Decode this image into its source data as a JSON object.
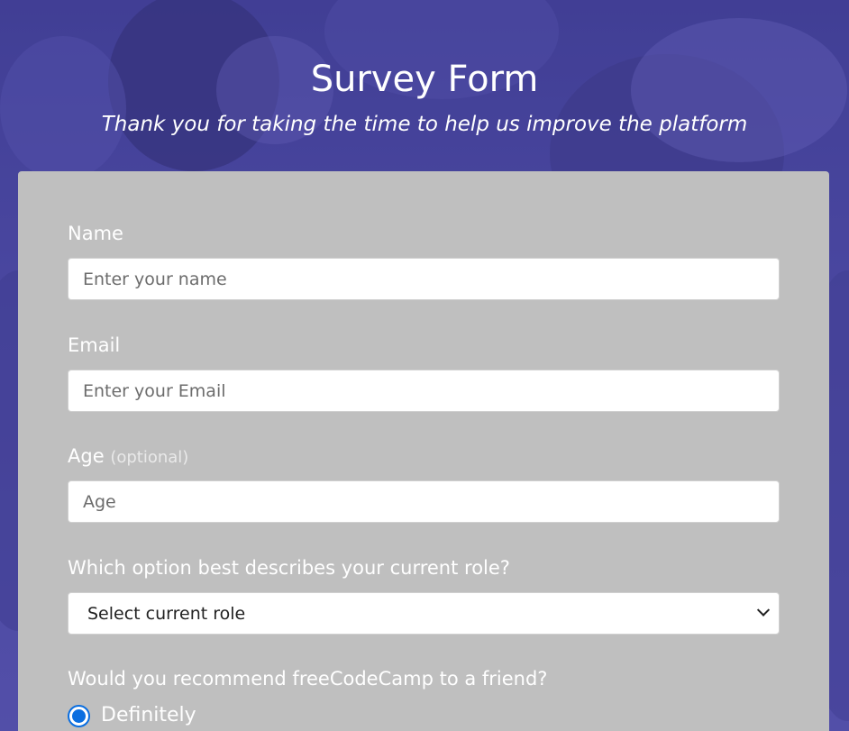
{
  "header": {
    "title": "Survey Form",
    "description": "Thank you for taking the time to help us improve the platform"
  },
  "form": {
    "name": {
      "label": "Name",
      "placeholder": "Enter your name"
    },
    "email": {
      "label": "Email",
      "placeholder": "Enter your Email"
    },
    "age": {
      "label": "Age",
      "optional": "(optional)",
      "placeholder": "Age"
    },
    "role": {
      "label": "Which option best describes your current role?",
      "selected": "Select current role"
    },
    "recommend": {
      "label": "Would you recommend freeCodeCamp to a friend?",
      "options": [
        {
          "label": "Definitely",
          "checked": true
        }
      ]
    }
  },
  "colors": {
    "background": "#4e4a9c",
    "card": "#bfbfbf",
    "accent": "#0a6ee0",
    "text": "#ffffff"
  },
  "icons": [
    "chevron-down-icon",
    "radio-checked-icon"
  ]
}
